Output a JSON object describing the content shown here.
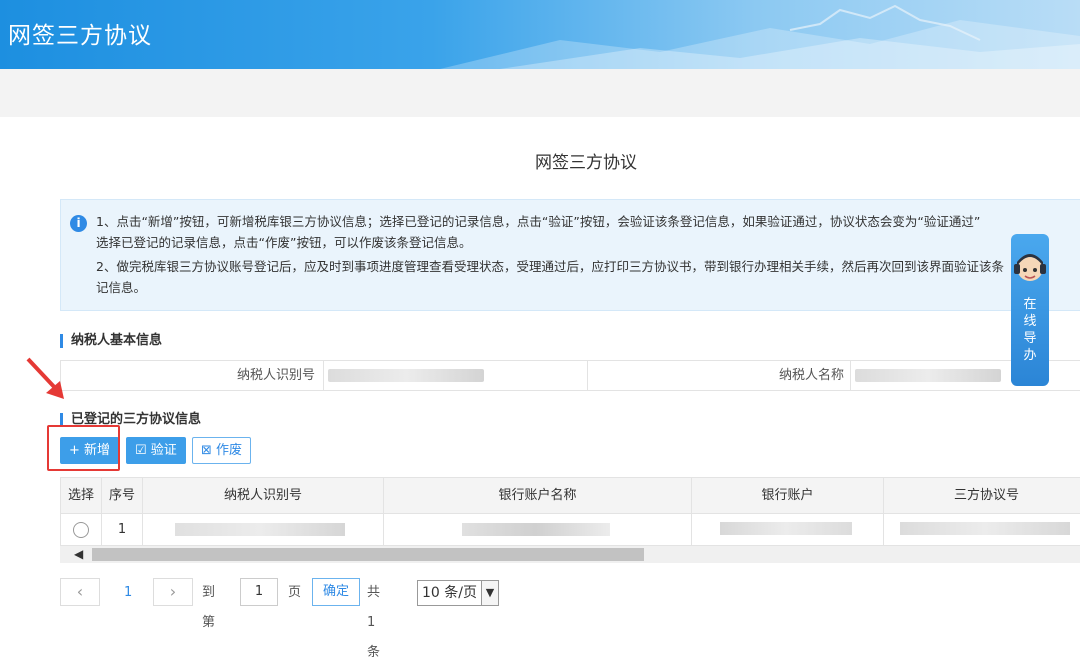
{
  "app": {
    "header_title": "网签三方协议"
  },
  "page": {
    "title": "网签三方协议"
  },
  "notice": {
    "line1": "1、点击“新增”按钮，可新增税库银三方协议信息；选择已登记的记录信息，点击“验证”按钮，会验证该条登记信息，如果验证通过，协议状态会变为“验证通过”",
    "line2": "选择已登记的记录信息，点击“作废”按钮，可以作废该条登记信息。",
    "line3": "2、做完税库银三方协议账号登记后，应及时到事项进度管理查看受理状态，受理通过后，应打印三方协议书，带到银行办理相关手续，然后再次回到该界面验证该条",
    "line4": "记信息。"
  },
  "taxpayer": {
    "section_title": "纳税人基本信息",
    "id_label": "纳税人识别号",
    "name_label": "纳税人名称"
  },
  "agreements": {
    "section_title": "已登记的三方协议信息",
    "add_label": "+ 新增",
    "verify_label": "验证",
    "void_label": "作废",
    "columns": [
      "选择",
      "序号",
      "纳税人识别号",
      "银行账户名称",
      "银行账户",
      "三方协议号"
    ],
    "rows": [
      {
        "seq": "1"
      }
    ]
  },
  "pager": {
    "current_page": "1",
    "goto_label": "到第",
    "page_input": "1",
    "page_unit": "页",
    "confirm_label": "确定",
    "total_text": "共 1 条",
    "page_size": "10 条/页"
  },
  "guide": {
    "label_chars": [
      "在",
      "线",
      "导",
      "办"
    ]
  },
  "colors": {
    "accent": "#2f8ae5",
    "button_blue": "#3d9ee9",
    "highlight_red": "#e53935"
  }
}
